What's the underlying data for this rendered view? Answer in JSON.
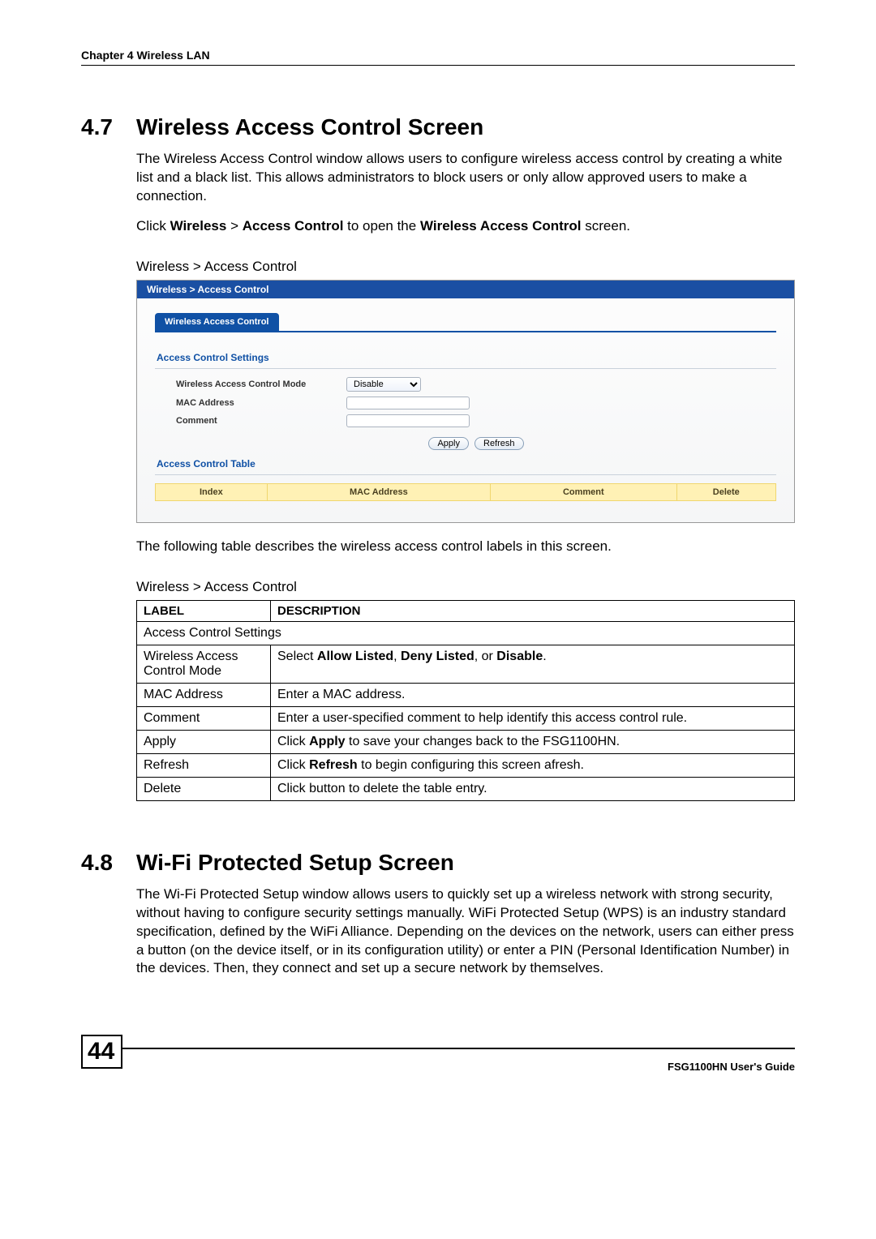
{
  "header": {
    "chapter": "Chapter 4 Wireless LAN"
  },
  "section47": {
    "num": "4.7",
    "title": "Wireless Access Control Screen",
    "para1": "The Wireless Access Control window allows users to configure wireless access control by creating a white list and a black list. This allows administrators to block users or only allow approved users to make a connection.",
    "para2_pre": "Click ",
    "para2_b1": "Wireless",
    "para2_gt": " > ",
    "para2_b2": "Access Control",
    "para2_mid": " to open the ",
    "para2_b3": "Wireless Access Control",
    "para2_post": " screen.",
    "caption1": "Wireless > Access Control"
  },
  "ui": {
    "titlebar": "Wireless > Access Control",
    "tab": "Wireless Access Control",
    "settings_title": "Access Control Settings",
    "row_mode": "Wireless Access Control Mode",
    "mode_selected": "Disable",
    "row_mac": "MAC Address",
    "row_comment": "Comment",
    "btn_apply": "Apply",
    "btn_refresh": "Refresh",
    "table_title": "Access Control Table",
    "th_index": "Index",
    "th_mac": "MAC Address",
    "th_comment": "Comment",
    "th_delete": "Delete"
  },
  "after_ui": "The following table describes the wireless access control labels in this screen.",
  "desc_caption": "Wireless > Access Control",
  "desc": {
    "h_label": "LABEL",
    "h_desc": "DESCRIPTION",
    "r0": "Access Control Settings",
    "r1l": "Wireless Access Control Mode",
    "r1_pre": "Select ",
    "r1_b1": "Allow Listed",
    "r1_c": ", ",
    "r1_b2": "Deny Listed",
    "r1_or": ", or ",
    "r1_b3": "Disable",
    "r1_post": ".",
    "r2l": "MAC Address",
    "r2d": "Enter a MAC address.",
    "r3l": "Comment",
    "r3d": "Enter a user-specified comment to help identify this access control rule.",
    "r4l": "Apply",
    "r4_pre": "Click ",
    "r4_b": "Apply",
    "r4_post": " to save your changes back to the FSG1100HN.",
    "r5l": "Refresh",
    "r5_pre": "Click ",
    "r5_b": "Refresh",
    "r5_post": " to begin configuring this screen afresh.",
    "r6l": "Delete",
    "r6d": "Click button to delete the table entry."
  },
  "section48": {
    "num": "4.8",
    "title": "Wi-Fi Protected Setup Screen",
    "para": "The Wi-Fi Protected Setup window allows users to quickly set up a wireless network with strong security, without having to configure security settings manually. WiFi Protected Setup (WPS) is an industry standard specification, defined by the WiFi Alliance. Depending on the devices on the network, users can either press a button (on the device itself, or in its configuration utility) or enter a PIN (Personal Identification Number) in the devices. Then, they connect and set up a secure network by themselves."
  },
  "footer": {
    "page": "44",
    "guide": "FSG1100HN User's Guide"
  }
}
